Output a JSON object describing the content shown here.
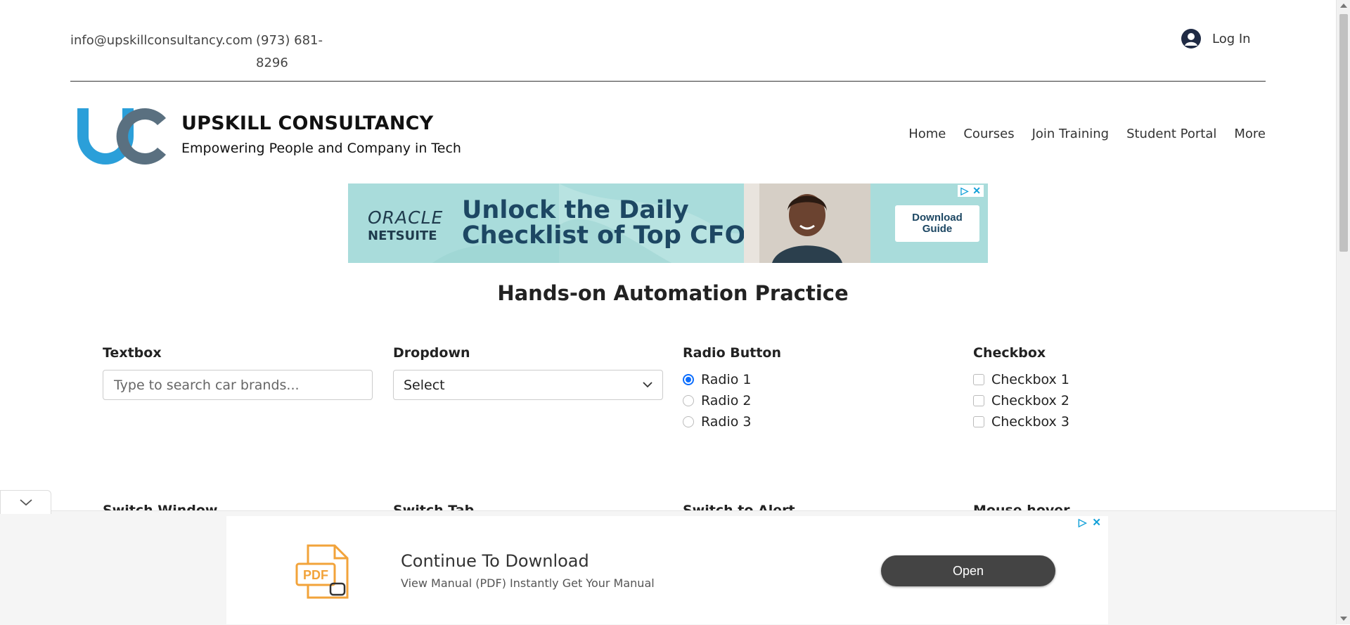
{
  "topbar": {
    "email": "info@upskillconsultancy.com",
    "phone": "(973) 681-8296",
    "login_label": "Log In"
  },
  "brand": {
    "title": "UPSKILL CONSULTANCY",
    "subtitle": "Empowering People and Company in Tech",
    "logo_colors": [
      "#2b9fd9",
      "#5a7080"
    ]
  },
  "nav": {
    "items": [
      {
        "label": "Home"
      },
      {
        "label": "Courses"
      },
      {
        "label": "Join Training"
      },
      {
        "label": "Student Portal"
      },
      {
        "label": "More"
      }
    ]
  },
  "top_ad": {
    "brand_line1": "ORACLE",
    "brand_line2": "NETSUITE",
    "headline_line1": "Unlock the Daily",
    "headline_line2": "Checklist of Top CFOs",
    "cta_line1": "Download",
    "cta_line2": "Guide"
  },
  "page": {
    "heading": "Hands-on Automation Practice"
  },
  "sections": {
    "textbox": {
      "label": "Textbox",
      "placeholder": "Type to search car brands..."
    },
    "dropdown": {
      "label": "Dropdown",
      "selected": "Select"
    },
    "radio": {
      "label": "Radio Button",
      "options": [
        {
          "label": "Radio 1",
          "checked": true
        },
        {
          "label": "Radio 2",
          "checked": false
        },
        {
          "label": "Radio 3",
          "checked": false
        }
      ]
    },
    "checkbox": {
      "label": "Checkbox",
      "options": [
        {
          "label": "Checkbox 1",
          "checked": false
        },
        {
          "label": "Checkbox 2",
          "checked": false
        },
        {
          "label": "Checkbox 3",
          "checked": false
        }
      ]
    },
    "row2": [
      {
        "label": "Switch Window"
      },
      {
        "label": "Switch Tab"
      },
      {
        "label": "Switch to Alert"
      },
      {
        "label": "Mouse hover"
      }
    ]
  },
  "bottom_ad": {
    "icon_label": "PDF",
    "title": "Continue To Download",
    "description": "View Manual (PDF) Instantly Get Your Manual",
    "button_label": "Open"
  },
  "colors": {
    "accent": "#0d6efd",
    "ad_bg": "#a9dcdb",
    "ad_choice": "#12a0d8"
  }
}
